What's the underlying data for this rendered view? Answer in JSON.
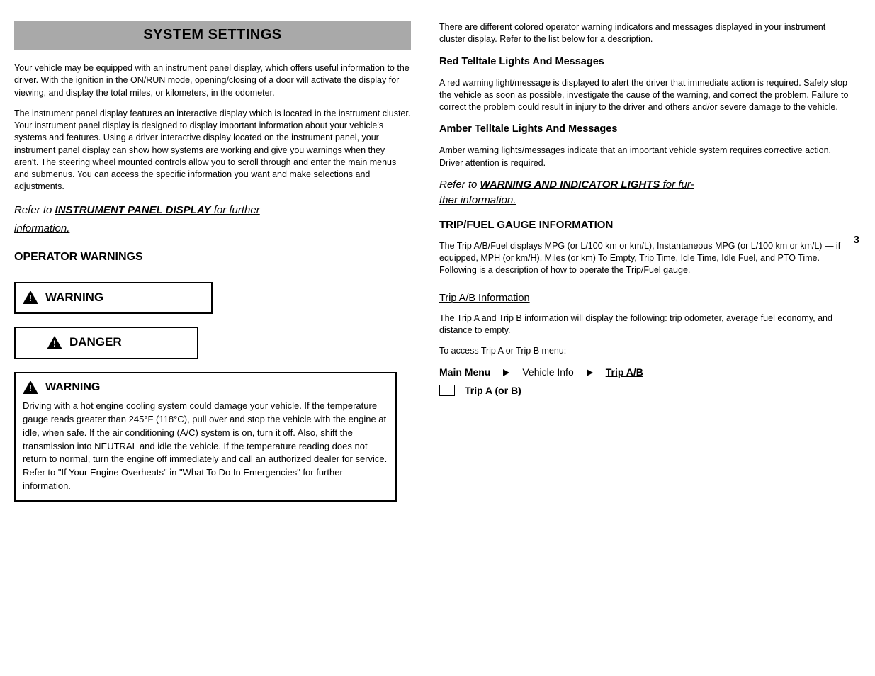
{
  "left": {
    "banner": "SYSTEM SETTINGS",
    "p1": "Your vehicle may be equipped with an instrument panel display, which offers useful information to the driver. With the ignition in the ON/RUN mode, opening/closing of a door will activate the display for viewing, and display the total miles, or kilometers, in the odometer.",
    "p2": "The instrument panel display features an interactive display which is located in the instrument cluster. Your instrument panel display is designed to display important information about your vehicle's systems and features. Using a driver interactive display located on the instrument panel, your instrument panel display can show how systems are working and give you warnings when they aren't. The steering wheel mounted controls allow you to scroll through and enter the main menus and submenus. You can access the specific information you want and make selections and adjustments.",
    "ref_prefix": "Refer to ",
    "ref_bold": "INSTRUMENT PANEL DISPLAY",
    "ref_after": " for further",
    "sub_ref": "information.",
    "info_title": "OPERATOR WARNINGS",
    "warning_label": "WARNING",
    "danger_label": "DANGER",
    "big_warning_label": "WARNING",
    "big_warning_body": "Driving with a hot engine cooling system could damage your vehicle. If the temperature gauge reads greater than 245°F (118°C), pull over and stop the vehicle with the engine at idle, when safe. If the air conditioning (A/C) system is on, turn it off. Also, shift the transmission into NEUTRAL and idle the vehicle. If the temperature reading does not return to normal, turn the engine off immediately and call an authorized dealer for service. Refer to \"If Your Engine Overheats\" in \"What To Do In Emergencies\" for further information."
  },
  "right": {
    "p1": "There are different colored operator warning indicators and messages displayed in your instrument cluster display. Refer to the list below for a description.",
    "red_head": "Red Telltale Lights And Messages",
    "red_body": "A red warning light/message is displayed to alert the driver that immediate action is required. Safely stop the vehicle as soon as possible, investigate the cause of the warning, and correct the problem. Failure to correct the problem could result in injury to the driver and others and/or severe damage to the vehicle.",
    "amber_head": "Amber Telltale Lights And Messages",
    "amber_body": "Amber warning lights/messages indicate that an important vehicle system requires corrective action. Driver attention is required.",
    "ref2_prefix": "Refer to ",
    "ref2_bold": "WARNING AND INDICATOR LIGHTS",
    "ref2_after": " for fur-",
    "sub_ref2": "ther information.",
    "trip_head": "TRIP/FUEL GAUGE INFORMATION",
    "trip_body": "The Trip A/B/Fuel displays MPG (or L/100 km or km/L), Instantaneous MPG (or L/100 km or km/L) — if equipped, MPH (or km/H), Miles (or km) To Empty, Trip Time, Idle Time, Idle Fuel, and PTO Time. Following is a description of how to operate the Trip/Fuel gauge.",
    "trip_ab_head": "Trip A/B Information",
    "trip_ab_body": "The Trip A and Trip B information will display the following: trip odometer, average fuel economy, and distance to empty.",
    "trip_nav_intro": "To access Trip A or Trip B menu:",
    "menu_main": "Main Menu",
    "menu_vehicle": "Vehicle Info",
    "menu_trip": "Trip A/B",
    "menu_title": "Trip A (or B)"
  },
  "page_number": "3"
}
